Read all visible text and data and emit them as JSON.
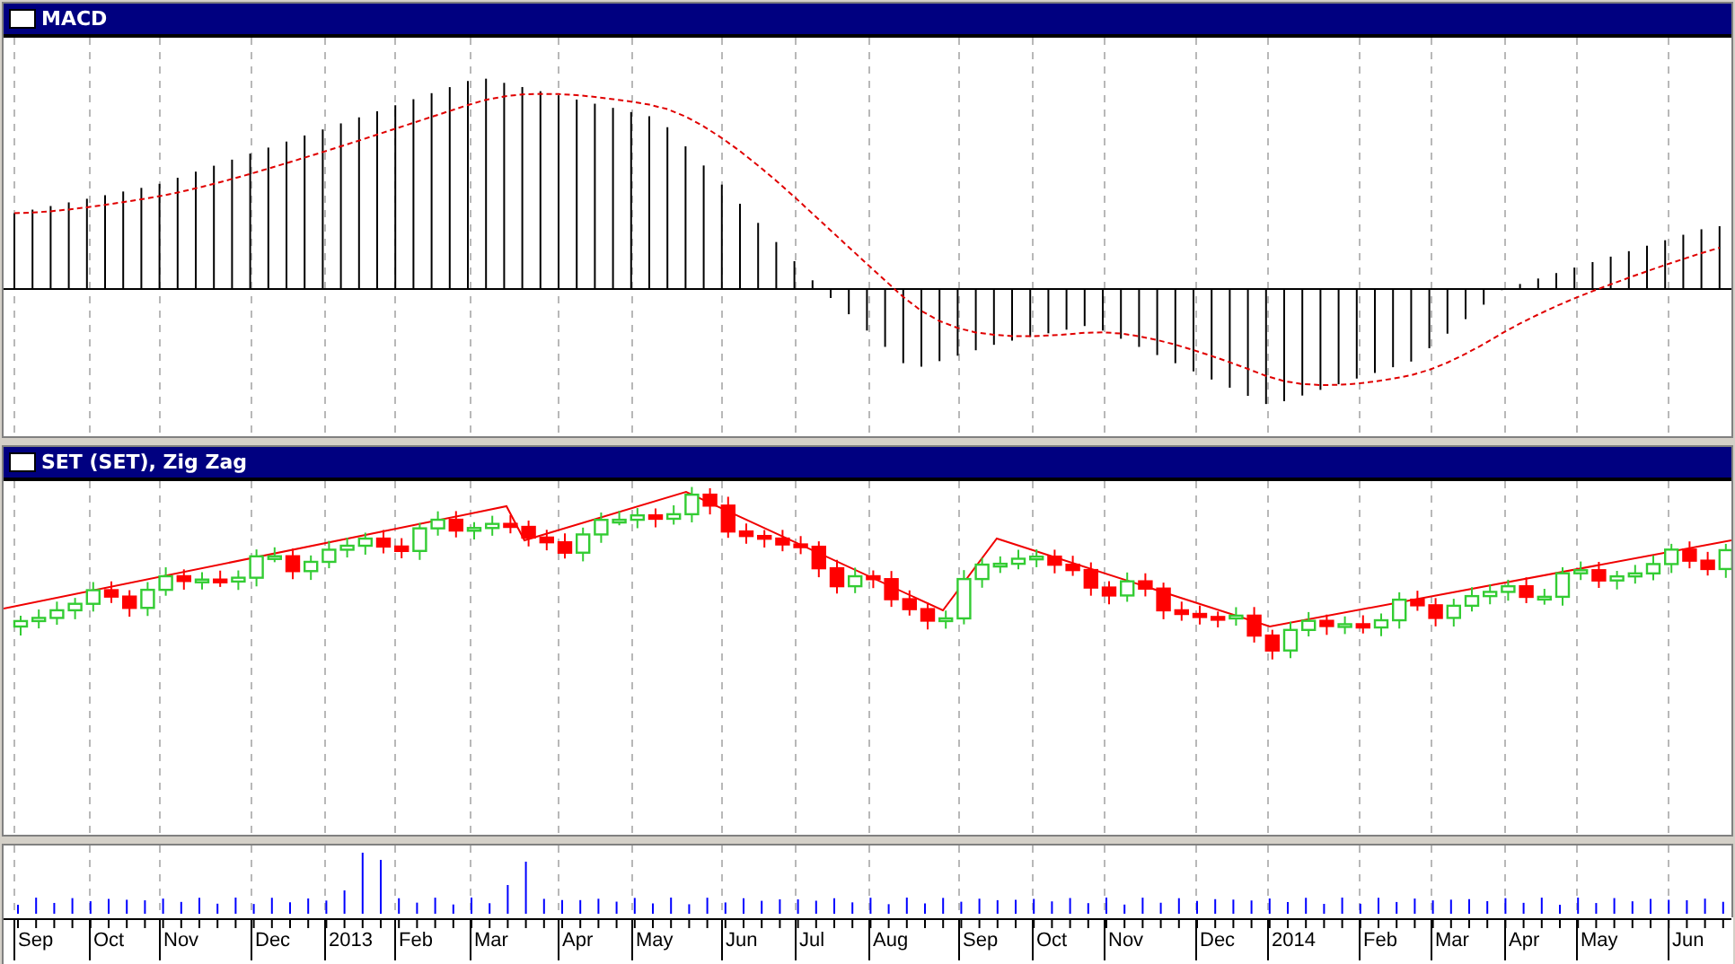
{
  "panels": [
    {
      "kind": "macd",
      "title": "MACD"
    },
    {
      "kind": "price",
      "title": "SET (SET), Zig Zag"
    },
    {
      "kind": "volume"
    }
  ],
  "x_axis": {
    "labels": [
      "Sep",
      "Oct",
      "Nov",
      "Dec",
      "2013",
      "Feb",
      "Mar",
      "Apr",
      "May",
      "Jun",
      "Jul",
      "Aug",
      "Sep",
      "Oct",
      "Nov",
      "Dec",
      "2014",
      "Feb",
      "Mar",
      "Apr",
      "May",
      "Jun"
    ]
  }
}
